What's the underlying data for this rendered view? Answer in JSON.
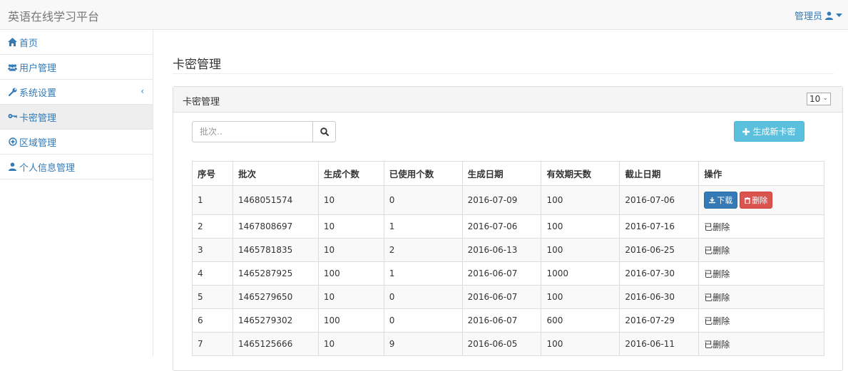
{
  "app": {
    "title": "英语在线学习平台",
    "user": "管理员"
  },
  "sidebar": {
    "items": [
      {
        "label": "首页",
        "icon": "home-icon"
      },
      {
        "label": "用户管理",
        "icon": "users-icon"
      },
      {
        "label": "系统设置",
        "icon": "wrench-icon",
        "chevron": "‹"
      },
      {
        "label": "卡密管理",
        "icon": "key-icon",
        "active": true
      },
      {
        "label": "区域管理",
        "icon": "globe-icon"
      },
      {
        "label": "个人信息管理",
        "icon": "user-icon"
      }
    ]
  },
  "page": {
    "title": "卡密管理"
  },
  "panel": {
    "title": "卡密管理",
    "page_size": "10",
    "search_placeholder": "批次..",
    "generate_label": "生成新卡密"
  },
  "table": {
    "headers": [
      "序号",
      "批次",
      "生成个数",
      "已使用个数",
      "生成日期",
      "有效期天数",
      "截止日期",
      "操作"
    ],
    "rows": [
      [
        "1",
        "1468051574",
        "10",
        "0",
        "2016-07-09",
        "100",
        "2016-07-06",
        ""
      ],
      [
        "2",
        "1467808697",
        "10",
        "1",
        "2016-07-06",
        "100",
        "2016-07-16",
        "已删除"
      ],
      [
        "3",
        "1465781835",
        "10",
        "2",
        "2016-06-13",
        "100",
        "2016-06-25",
        "已删除"
      ],
      [
        "4",
        "1465287925",
        "100",
        "1",
        "2016-06-07",
        "1000",
        "2016-07-30",
        "已删除"
      ],
      [
        "5",
        "1465279650",
        "10",
        "0",
        "2016-06-07",
        "100",
        "2016-06-30",
        "已删除"
      ],
      [
        "6",
        "1465279302",
        "100",
        "0",
        "2016-06-07",
        "600",
        "2016-07-29",
        "已删除"
      ],
      [
        "7",
        "1465125666",
        "10",
        "9",
        "2016-06-05",
        "100",
        "2016-06-11",
        "已删除"
      ]
    ],
    "download_label": "下载",
    "delete_label": "删除"
  },
  "colors": {
    "link": "#337ab7",
    "info": "#5bc0de",
    "primary": "#337ab7",
    "danger": "#d9534f"
  }
}
